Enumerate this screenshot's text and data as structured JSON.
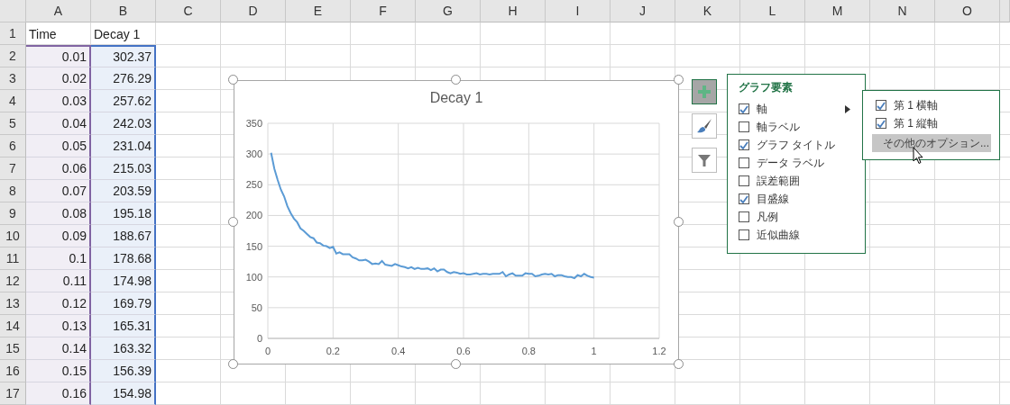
{
  "columns": [
    {
      "label": "A",
      "color": "#8064a2"
    },
    {
      "label": "B",
      "color": "#4472c4"
    },
    {
      "label": "C"
    },
    {
      "label": "D"
    },
    {
      "label": "E"
    },
    {
      "label": "F"
    },
    {
      "label": "G"
    },
    {
      "label": "H"
    },
    {
      "label": "I"
    },
    {
      "label": "J"
    },
    {
      "label": "K"
    },
    {
      "label": "L"
    },
    {
      "label": "M"
    },
    {
      "label": "N"
    },
    {
      "label": "O"
    }
  ],
  "rows": [
    {
      "number": "1",
      "cells": [
        "Time",
        "Decay 1"
      ]
    },
    {
      "number": "2",
      "cells": [
        "0.01",
        "302.37"
      ]
    },
    {
      "number": "3",
      "cells": [
        "0.02",
        "276.29"
      ]
    },
    {
      "number": "4",
      "cells": [
        "0.03",
        "257.62"
      ]
    },
    {
      "number": "5",
      "cells": [
        "0.04",
        "242.03"
      ]
    },
    {
      "number": "6",
      "cells": [
        "0.05",
        "231.04"
      ]
    },
    {
      "number": "7",
      "cells": [
        "0.06",
        "215.03"
      ]
    },
    {
      "number": "8",
      "cells": [
        "0.07",
        "203.59"
      ]
    },
    {
      "number": "9",
      "cells": [
        "0.08",
        "195.18"
      ]
    },
    {
      "number": "10",
      "cells": [
        "0.09",
        "188.67"
      ]
    },
    {
      "number": "11",
      "cells": [
        "0.1",
        "178.68"
      ]
    },
    {
      "number": "12",
      "cells": [
        "0.11",
        "174.98"
      ]
    },
    {
      "number": "13",
      "cells": [
        "0.12",
        "169.79"
      ]
    },
    {
      "number": "14",
      "cells": [
        "0.13",
        "165.31"
      ]
    },
    {
      "number": "15",
      "cells": [
        "0.14",
        "163.32"
      ]
    },
    {
      "number": "16",
      "cells": [
        "0.15",
        "156.39"
      ]
    },
    {
      "number": "17",
      "cells": [
        "0.16",
        "154.98"
      ]
    }
  ],
  "chart": {
    "chart_data": {
      "type": "line",
      "title": "Decay 1",
      "x": [
        0.01,
        0.02,
        0.03,
        0.04,
        0.05,
        0.06,
        0.07,
        0.08,
        0.09,
        0.1,
        0.11,
        0.12,
        0.13,
        0.14,
        0.15,
        0.16,
        0.17,
        0.18,
        0.19,
        0.2,
        0.21,
        0.22,
        0.23,
        0.24,
        0.25,
        0.26,
        0.27,
        0.28,
        0.29,
        0.3,
        0.31,
        0.32,
        0.33,
        0.34,
        0.35,
        0.36,
        0.37,
        0.38,
        0.39,
        0.4,
        0.41,
        0.42,
        0.43,
        0.44,
        0.45,
        0.46,
        0.47,
        0.48,
        0.49,
        0.5,
        0.51,
        0.52,
        0.53,
        0.54,
        0.55,
        0.56,
        0.57,
        0.58,
        0.59,
        0.6,
        0.61,
        0.62,
        0.63,
        0.64,
        0.65,
        0.66,
        0.67,
        0.68,
        0.69,
        0.7,
        0.71,
        0.72,
        0.73,
        0.74,
        0.75,
        0.76,
        0.77,
        0.78,
        0.79,
        0.8,
        0.81,
        0.82,
        0.83,
        0.84,
        0.85,
        0.86,
        0.87,
        0.88,
        0.89,
        0.9,
        0.91,
        0.92,
        0.93,
        0.94,
        0.95,
        0.96,
        0.97,
        0.98,
        0.99,
        1.0
      ],
      "grid": true,
      "series": [
        {
          "color": "#5b9bd5",
          "values": [
            302,
            276,
            258,
            242,
            231,
            215,
            204,
            195,
            189,
            179,
            175,
            170,
            165,
            163,
            156,
            155,
            151,
            150,
            147,
            149,
            138,
            140,
            137,
            137,
            137,
            132,
            130,
            127,
            127,
            128,
            125,
            121,
            122,
            121,
            126,
            120,
            119,
            118,
            121,
            119,
            117,
            116,
            114,
            116,
            113,
            115,
            113,
            113,
            114,
            111,
            114,
            109,
            112,
            112,
            108,
            106,
            108,
            107,
            105,
            106,
            104,
            104,
            105,
            106,
            104,
            105,
            105,
            104,
            105,
            105,
            105,
            108,
            101,
            104,
            106,
            102,
            102,
            102,
            106,
            105,
            105,
            101,
            102,
            104,
            105,
            104,
            105,
            101,
            103,
            103,
            101,
            100,
            100,
            98,
            103,
            101,
            105,
            102,
            100,
            99
          ]
        }
      ],
      "xlim": [
        0,
        1.2
      ],
      "ylim": [
        0,
        350
      ],
      "xticks": [
        0,
        0.2,
        0.4,
        0.6,
        0.8,
        1,
        1.2
      ],
      "yticks": [
        0,
        50,
        100,
        150,
        200,
        250,
        300,
        350
      ]
    }
  },
  "chart_tools": [
    {
      "kind": "elements",
      "selected": true
    },
    {
      "kind": "styles",
      "selected": false
    },
    {
      "kind": "filter",
      "selected": false
    }
  ],
  "elements_panel": {
    "title": "グラフ要素",
    "items": [
      {
        "label": "軸",
        "checked": true,
        "has_submenu": true
      },
      {
        "label": "軸ラベル",
        "checked": false
      },
      {
        "label": "グラフ タイトル",
        "checked": true
      },
      {
        "label": "データ ラベル",
        "checked": false
      },
      {
        "label": "誤差範囲",
        "checked": false
      },
      {
        "label": "目盛線",
        "checked": true
      },
      {
        "label": "凡例",
        "checked": false
      },
      {
        "label": "近似曲線",
        "checked": false
      }
    ]
  },
  "axis_submenu": {
    "items": [
      {
        "label": "第 1 横軸",
        "checked": true
      },
      {
        "label": "第 1 縦軸",
        "checked": true
      }
    ],
    "more_options": {
      "label": "その他のオプション...",
      "highlighted": true
    }
  }
}
